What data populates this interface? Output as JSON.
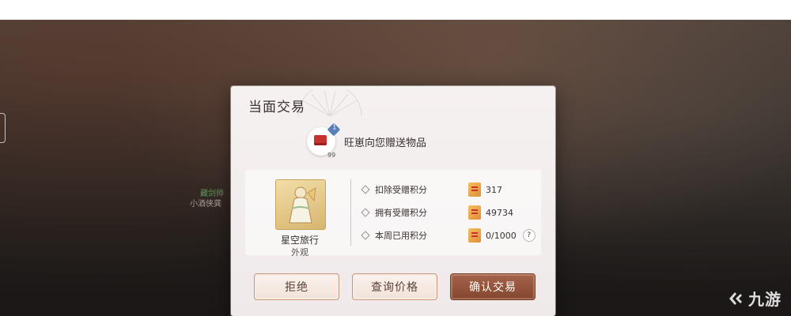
{
  "watermark": {
    "brand": "九游"
  },
  "scene": {
    "npc_name": "藏剑师",
    "npc_title": "小酒侠龚"
  },
  "dialog": {
    "title": "当面交易",
    "sender": {
      "message": "旺崽向您赠送物品",
      "item_count": "99",
      "badge": "1"
    },
    "item": {
      "name": "星空旅行",
      "type": "外观"
    },
    "stats": [
      {
        "label": "扣除受赠积分",
        "value": "317",
        "icon": "points-ticket-icon"
      },
      {
        "label": "拥有受赠积分",
        "value": "49734",
        "icon": "points-ticket-icon"
      },
      {
        "label": "本周已用积分",
        "value": "0/1000",
        "icon": "points-ticket-icon",
        "help": "?"
      }
    ],
    "buttons": {
      "reject": "拒绝",
      "check_price": "查询价格",
      "confirm": "确认交易"
    }
  },
  "colors": {
    "primary_button": "#85462f",
    "light_button_border": "#c79a7e",
    "title_text": "#3a3132"
  }
}
